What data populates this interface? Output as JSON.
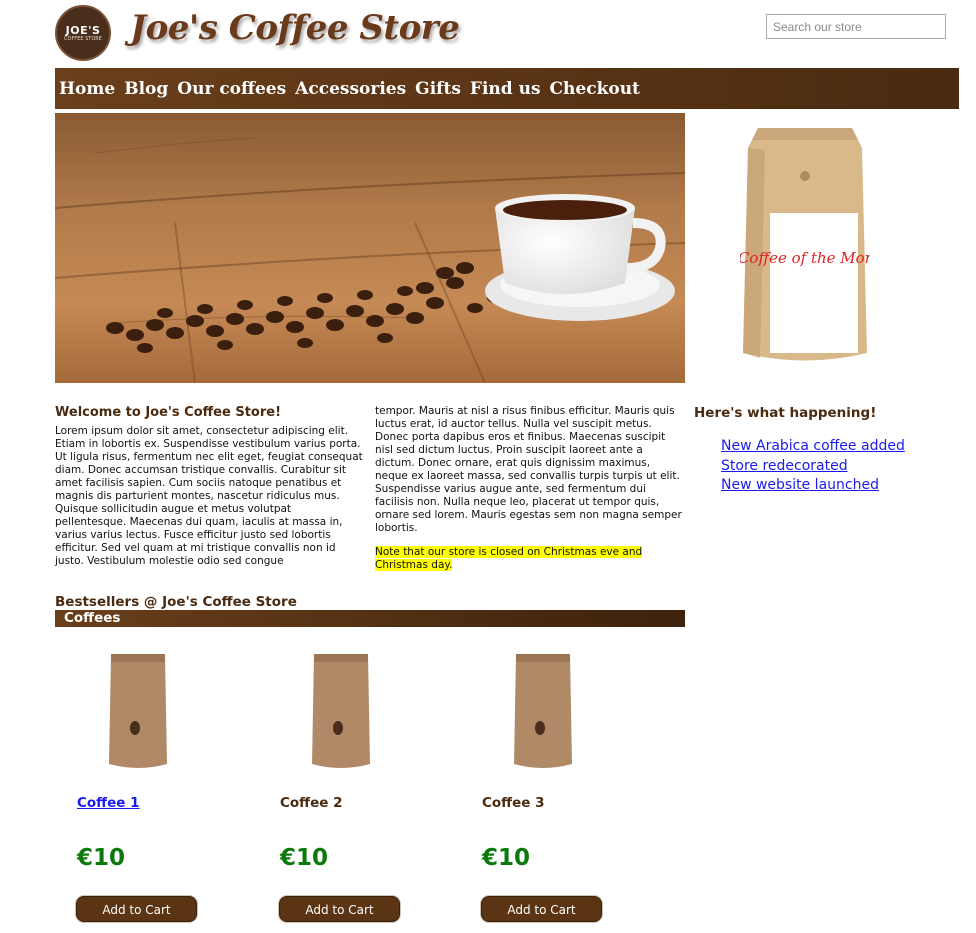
{
  "header": {
    "logo_line1": "JOE'S",
    "logo_line2": "COFFEE STORE",
    "brand_title": "Joe's Coffee Store",
    "search_placeholder": "Search our store"
  },
  "nav": {
    "items": [
      "Home",
      "Blog",
      "Our coffees",
      "Accessories",
      "Gifts",
      "Find us",
      "Checkout"
    ]
  },
  "promo": {
    "bag_text": "Coffee of the Month"
  },
  "welcome": {
    "title": "Welcome to Joe's Coffee Store!",
    "col1": "Lorem ipsum dolor sit amet, consectetur adipiscing elit. Etiam in lobortis ex. Suspendisse vestibulum varius porta. Ut ligula risus, fermentum nec elit eget, feugiat consequat diam. Donec accumsan tristique convallis. Curabitur sit amet facilisis sapien. Cum sociis natoque penatibus et magnis dis parturient montes, nascetur ridiculus mus. Quisque sollicitudin augue et metus volutpat pellentesque. Maecenas dui quam, iaculis at massa in, varius varius lectus. Fusce efficitur justo sed lobortis efficitur. Sed vel quam at mi tristique convallis non id justo. Vestibulum molestie odio sed congue",
    "col2": "tempor. Mauris at nisl a risus finibus efficitur. Mauris quis luctus erat, id auctor tellus. Nulla vel suscipit metus. Donec porta dapibus eros et finibus. Maecenas suscipit nisl sed dictum luctus. Proin suscipit laoreet ante a dictum. Donec ornare, erat quis dignissim maximus, neque ex laoreet massa, sed convallis turpis turpis ut elit. Suspendisse varius augue ante, sed fermentum dui facilisis non. Nulla neque leo, placerat ut tempor quis, ornare sed lorem. Mauris egestas sem non magna semper lobortis.",
    "note": "Note that our store is closed on Christmas eve and Christmas day."
  },
  "happenings": {
    "title": "Here's what happening!",
    "items": [
      "New Arabica coffee added",
      "Store redecorated",
      "New website launched"
    ]
  },
  "bestsellers": {
    "title": "Bestsellers @ Joe's Coffee Store",
    "category": "Coffees",
    "products": [
      {
        "name": "Coffee 1",
        "price": "€10",
        "button": "Add to Cart"
      },
      {
        "name": "Coffee 2",
        "price": "€10",
        "button": "Add to Cart"
      },
      {
        "name": "Coffee 3",
        "price": "€10",
        "button": "Add to Cart"
      }
    ]
  }
}
